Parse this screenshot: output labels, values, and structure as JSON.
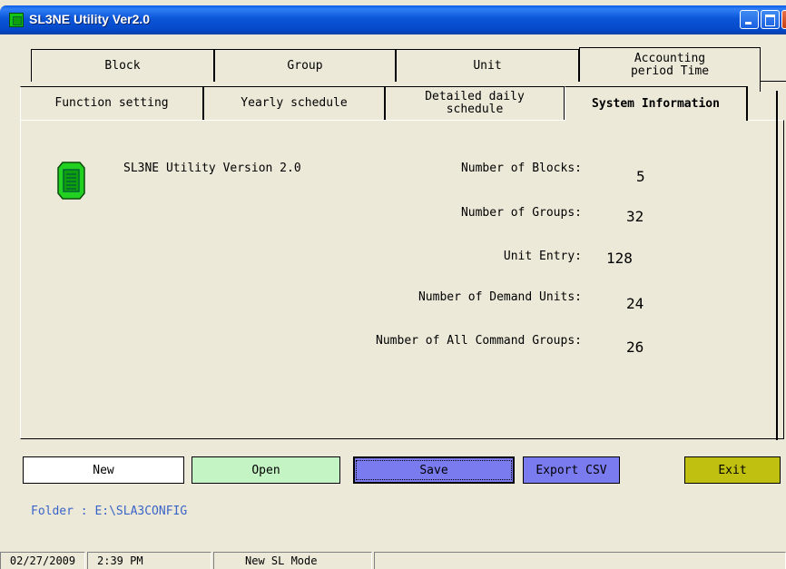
{
  "window": {
    "title": "SL3NE Utility Ver2.0"
  },
  "tabs_row1": [
    "Block",
    "Group",
    "Unit",
    "Accounting period Time"
  ],
  "tabs_row2": [
    "Function setting",
    "Yearly schedule",
    "Detailed daily schedule",
    "System Information"
  ],
  "active_tab": "System Information",
  "info": {
    "version": "SL3NE Utility Version 2.0",
    "blocks_label": "Number of Blocks:",
    "blocks_value": "5",
    "groups_label": "Number of Groups:",
    "groups_value": "32",
    "unit_entry_label": "Unit Entry:",
    "unit_entry_value": "128",
    "demand_label": "Number of Demand Units:",
    "demand_value": "24",
    "command_groups_label": "Number of All Command Groups:",
    "command_groups_value": "26"
  },
  "buttons": {
    "new": "New",
    "open": "Open",
    "save": "Save",
    "export": "Export CSV",
    "exit": "Exit"
  },
  "folder": "Folder : E:\\SLA3CONFIG",
  "status": {
    "date": "02/27/2009",
    "time": "2:39 PM",
    "mode": "New SL Mode"
  },
  "colors": {
    "title_bar": "#0548c8",
    "open_button": "#c4f3c4",
    "save_button": "#7b7bf0",
    "exit_button": "#c0c010",
    "folder_text": "#3a64c8",
    "icon_green": "#14c414"
  },
  "icons": [
    "app-icon",
    "minimize-icon",
    "maximize-icon",
    "close-icon",
    "chip-icon"
  ]
}
